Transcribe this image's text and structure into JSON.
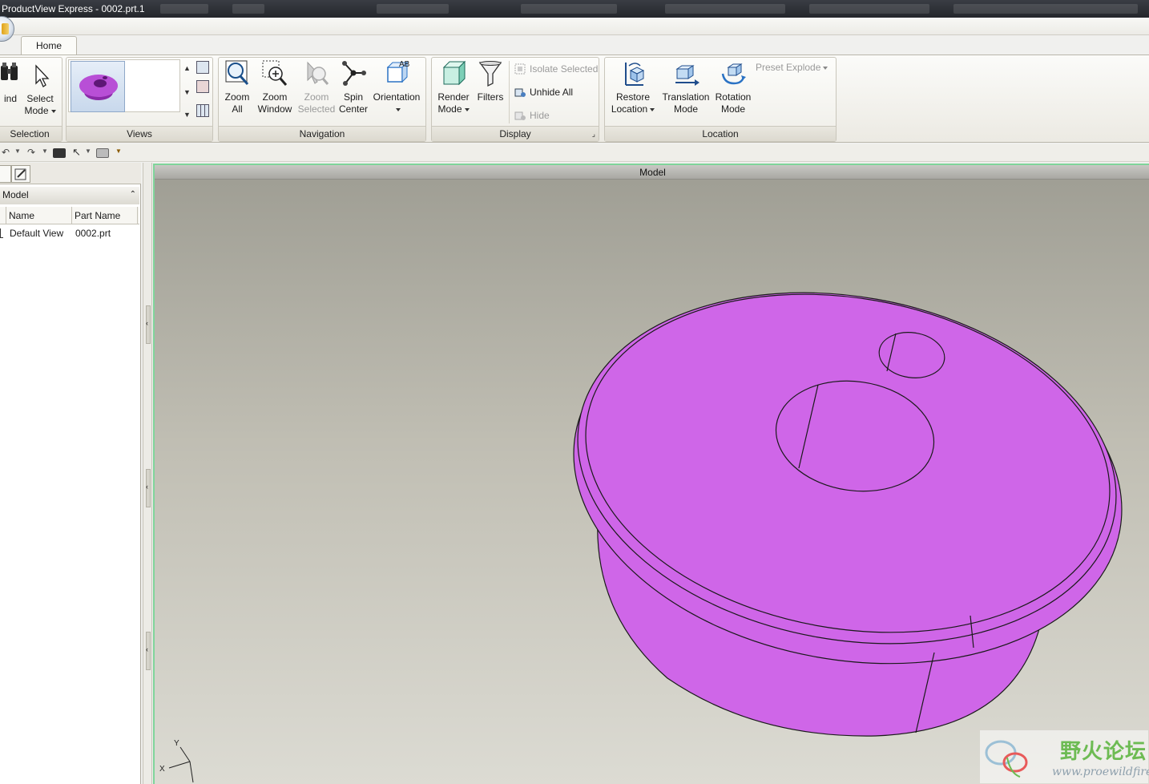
{
  "window": {
    "title": "ProductView Express - 0002.prt.1"
  },
  "tabs": [
    {
      "label": "Home"
    }
  ],
  "ribbon": {
    "selection": {
      "label": "Selection",
      "find_label": "ind",
      "select_mode_line1": "Select",
      "select_mode_line2": "Mode"
    },
    "views": {
      "label": "Views"
    },
    "navigation": {
      "label": "Navigation",
      "zoom_all": [
        "Zoom",
        "All"
      ],
      "zoom_window": [
        "Zoom",
        "Window"
      ],
      "zoom_selected": [
        "Zoom",
        "Selected"
      ],
      "spin_center": [
        "Spin",
        "Center"
      ],
      "orientation": "Orientation",
      "orientation_icon_text": "AB"
    },
    "display": {
      "label": "Display",
      "render_mode": [
        "Render",
        "Mode"
      ],
      "filters": "Filters",
      "isolate_selected": "Isolate Selected",
      "unhide_all": "Unhide All",
      "hide": "Hide"
    },
    "location": {
      "label": "Location",
      "restore_location": [
        "Restore",
        "Location"
      ],
      "translation_mode": [
        "Translation",
        "Mode"
      ],
      "rotation_mode": [
        "Rotation",
        "Mode"
      ],
      "preset_explode": "Preset Explode"
    }
  },
  "structure_pane": {
    "header": "Model",
    "columns": [
      "Name",
      "Part Name"
    ],
    "rows": [
      {
        "name": "Default View",
        "part_name": "0002.prt"
      }
    ]
  },
  "viewport": {
    "title": "Model",
    "model_color": "#cf66e8",
    "background_top": "#9e9d93",
    "background_bottom": "#dcdbd3",
    "triad": {
      "y_label": "Y",
      "x_label": "X"
    }
  },
  "watermark": {
    "text_cn": "野火论坛",
    "url": "www.proewildfire.cn",
    "color": "#6dbb53"
  },
  "colors": {
    "accent_border": "#7fd49a"
  }
}
